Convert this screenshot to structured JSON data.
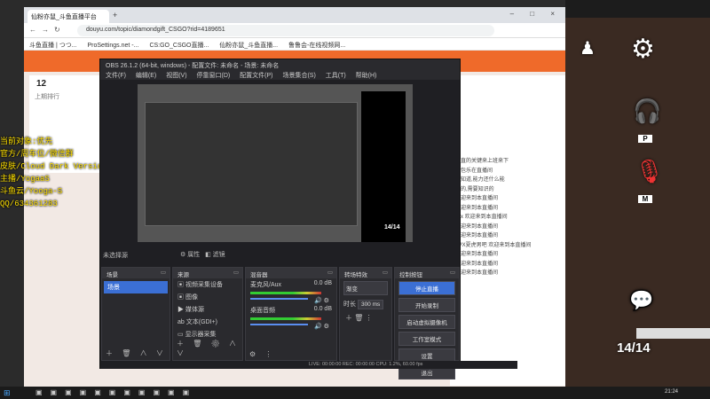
{
  "browser": {
    "tab_title": "仙粉亦鼠_斗鱼直播平台",
    "new_tab": "+",
    "window_controls": "– □ ×",
    "url": "douyu.com/topic/diamondgift_CSGO?rid=4189651",
    "bookmarks": [
      "斗鱼直播 | つつ...",
      "ProSettings.net -...",
      "CS:GO_CSGO直播...",
      "仙粉亦鼠_斗鱼直播...",
      "鲁鲁会-在线视频网..."
    ]
  },
  "page": {
    "left_number": "12",
    "left_caption": "上期排行",
    "chat_lines": [
      "直直的关键来上班来下",
      "总包乐在直播间",
      "的知道,能力还什么能",
      "好的,需要知识的",
      "欢迎来到本直播间",
      "欢迎来到本直播间",
      "xxx 欢迎来到本直播间",
      "欢迎来到本直播间",
      "欢迎来到本直播间",
      "FPX夏虎男吧 欢迎来到本直播间",
      "欢迎来到本直播间",
      "欢迎来到本直播间",
      "欢迎来到本直播间"
    ]
  },
  "overlay_text": [
    "当前对象:优先",
    "官方/周车位/微信群",
    "皮肤/Cloud Dark Version",
    "主播/YogaaS",
    "斗鱼云/Yooga-S",
    "QQ/634361283"
  ],
  "obs": {
    "title": "OBS 26.1.2 (64-bit, windows) - 配置文件: 未命名 - 场景: 未命名",
    "menu": [
      "文件(F)",
      "编辑(E)",
      "视图(V)",
      "停靠窗口(D)",
      "配置文件(P)",
      "场景集合(S)",
      "工具(T)",
      "帮助(H)"
    ],
    "no_source": "未选择源",
    "scene_buttons": [
      "属性",
      "滤镜"
    ],
    "scenes": {
      "title": "场景",
      "items": [
        "场景"
      ]
    },
    "sources": {
      "title": "来源",
      "items": [
        "视频采集设备",
        "图像",
        "媒体源",
        "文本(GDI+)",
        "显示器采集"
      ]
    },
    "mixer": {
      "title": "混音器",
      "channels": [
        {
          "name": "麦克风/Aux",
          "db": "0.0 dB"
        },
        {
          "name": "桌面音频",
          "db": "0.0 dB"
        }
      ]
    },
    "transitions": {
      "title": "转场特效",
      "type": "渐变",
      "duration_label": "时长",
      "duration": "300 ms"
    },
    "controls": {
      "title": "控制按钮",
      "buttons": [
        "停止直播",
        "开始录制",
        "启动虚拟摄像机",
        "工作室模式",
        "设置",
        "退出"
      ]
    },
    "status": "LIVE: 00:00:00    REC: 00:00:00    CPU: 1.2%, 60.00 fps",
    "preview_count": "14/14"
  },
  "stream_panel": {
    "p_label": "P",
    "m_label": "M",
    "count": "14/14"
  },
  "taskbar": {
    "clock": "21:24"
  }
}
